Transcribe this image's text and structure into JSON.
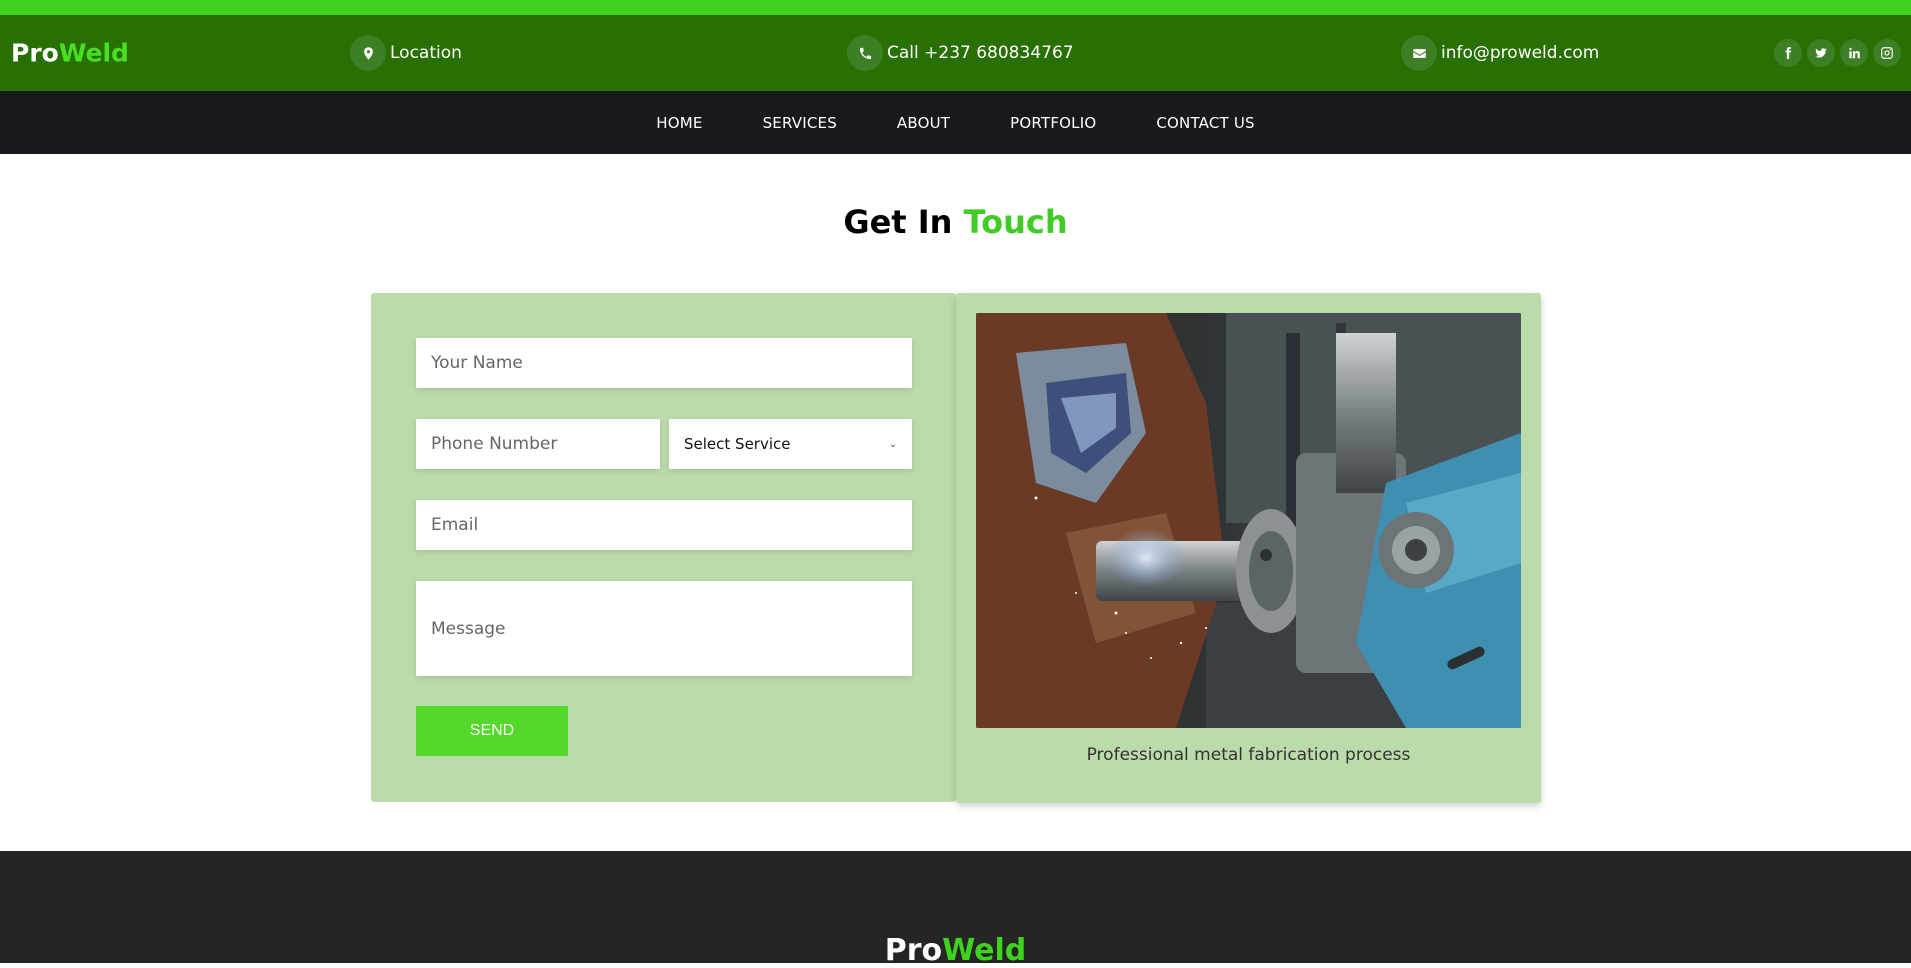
{
  "brand": {
    "pro": "Pro",
    "weld": "Weld"
  },
  "header": {
    "location": "Location",
    "phone": "Call +237 680834767",
    "email": "info@proweld.com",
    "socials": [
      "facebook-icon",
      "twitter-icon",
      "linkedin-icon",
      "instagram-icon"
    ]
  },
  "nav": {
    "items": [
      "HOME",
      "SERVICES",
      "ABOUT",
      "PORTFOLIO",
      "CONTACT US"
    ]
  },
  "section": {
    "title_dark": "Get In",
    "title_green": "Touch"
  },
  "form": {
    "name_placeholder": "Your Name",
    "phone_placeholder": "Phone Number",
    "service_selected": "Select Service",
    "email_placeholder": "Email",
    "message_placeholder": "Message",
    "send_label": "SEND"
  },
  "media": {
    "caption": "Professional metal fabrication process"
  },
  "footer": {
    "pro": "Pro",
    "weld": "Weld"
  },
  "colors": {
    "accent": "#3fd21f",
    "header": "#286f04",
    "nav": "#17191d",
    "panel": "#bbdbab",
    "footer": "#252525"
  }
}
